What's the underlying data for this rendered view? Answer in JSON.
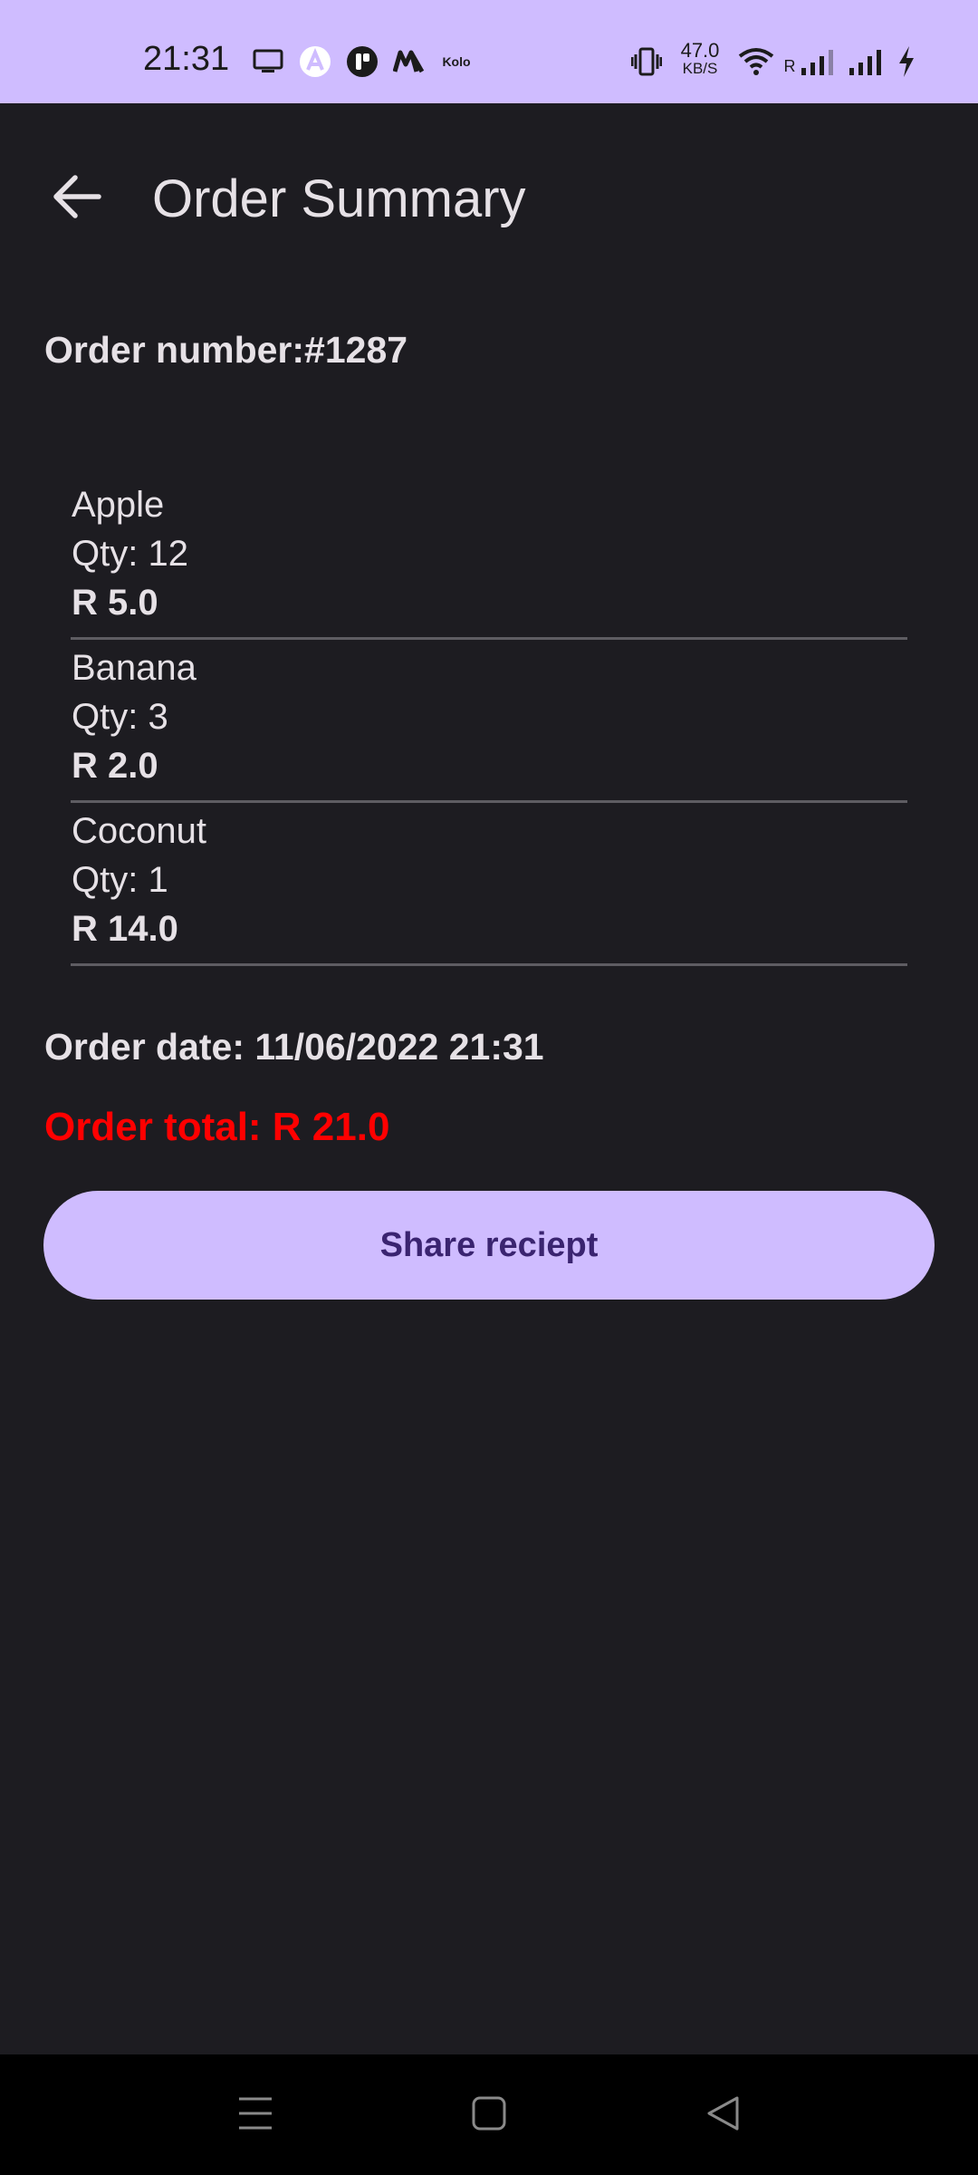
{
  "status_bar": {
    "time": "21:31",
    "net_speed_value": "47.0",
    "net_speed_unit": "KB/S",
    "carrier_app_label": "Kolo",
    "roaming_label": "R",
    "icons": [
      "tv-icon",
      "app-a-icon",
      "app-t-icon",
      "app-m-icon",
      "kolo-icon",
      "vibrate-icon",
      "wifi-icon",
      "signal-roaming-icon",
      "signal-icon",
      "charging-icon"
    ]
  },
  "app_bar": {
    "title": "Order Summary",
    "back_icon": "arrow-left-icon"
  },
  "order": {
    "number_label": "Order number:#1287",
    "items": [
      {
        "name": "Apple",
        "qty": "Qty: 12",
        "price": "R 5.0"
      },
      {
        "name": "Banana",
        "qty": "Qty: 3",
        "price": "R 2.0"
      },
      {
        "name": "Coconut",
        "qty": "Qty: 1",
        "price": "R 14.0"
      }
    ],
    "date_label": "Order date: 11/06/2022 21:31",
    "total_label": "Order total: R 21.0",
    "total_color": "#ff0000"
  },
  "actions": {
    "share_label": "Share reciept"
  },
  "nav_bar": {
    "buttons": [
      "menu-icon",
      "home-icon",
      "back-icon"
    ]
  },
  "colors": {
    "accent": "#cfbcff",
    "background": "#1d1c21",
    "on_accent": "#3a2470",
    "text": "#e6e1e6"
  }
}
